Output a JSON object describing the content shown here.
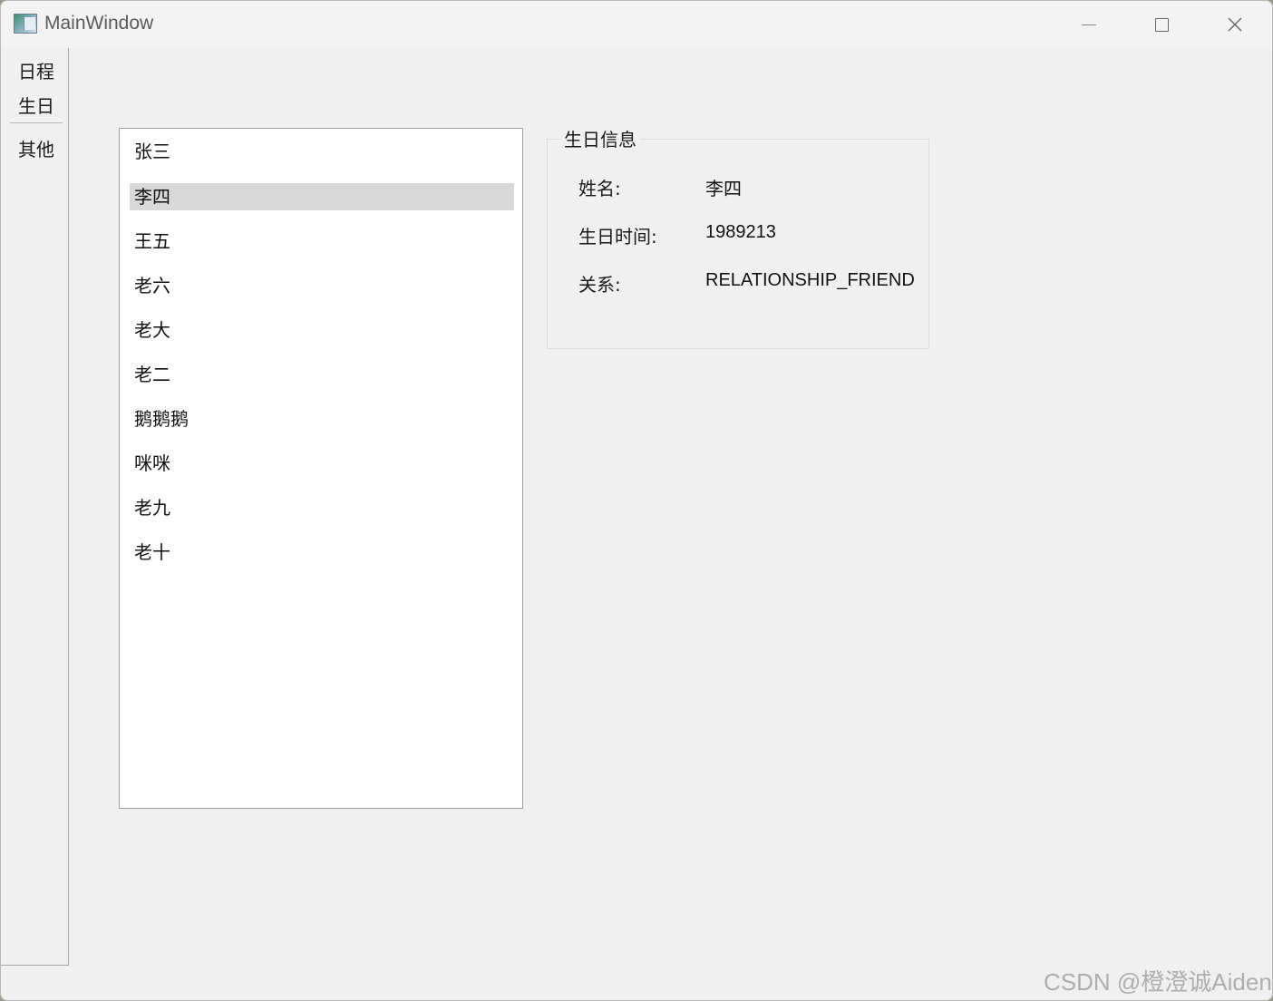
{
  "window": {
    "title": "MainWindow"
  },
  "side_tabs": [
    {
      "label": "日程"
    },
    {
      "label": "生日"
    },
    {
      "label": "其他"
    }
  ],
  "list": {
    "items": [
      "张三",
      "李四",
      "王五",
      "老六",
      "老大",
      "老二",
      "鹅鹅鹅",
      "咪咪",
      "老九",
      "老十"
    ],
    "selected": "李四"
  },
  "info": {
    "group_title": "生日信息",
    "name_label": "姓名:",
    "name_value": "李四",
    "time_label": "生日时间:",
    "time_value": "1989213",
    "relation_label": "关系:",
    "relation_value": "RELATIONSHIP_FRIEND"
  },
  "watermark": "CSDN @橙澄诚Aiden",
  "colors": {
    "window_bg": "#f0f0f0",
    "selection": "#d9d9d9"
  }
}
